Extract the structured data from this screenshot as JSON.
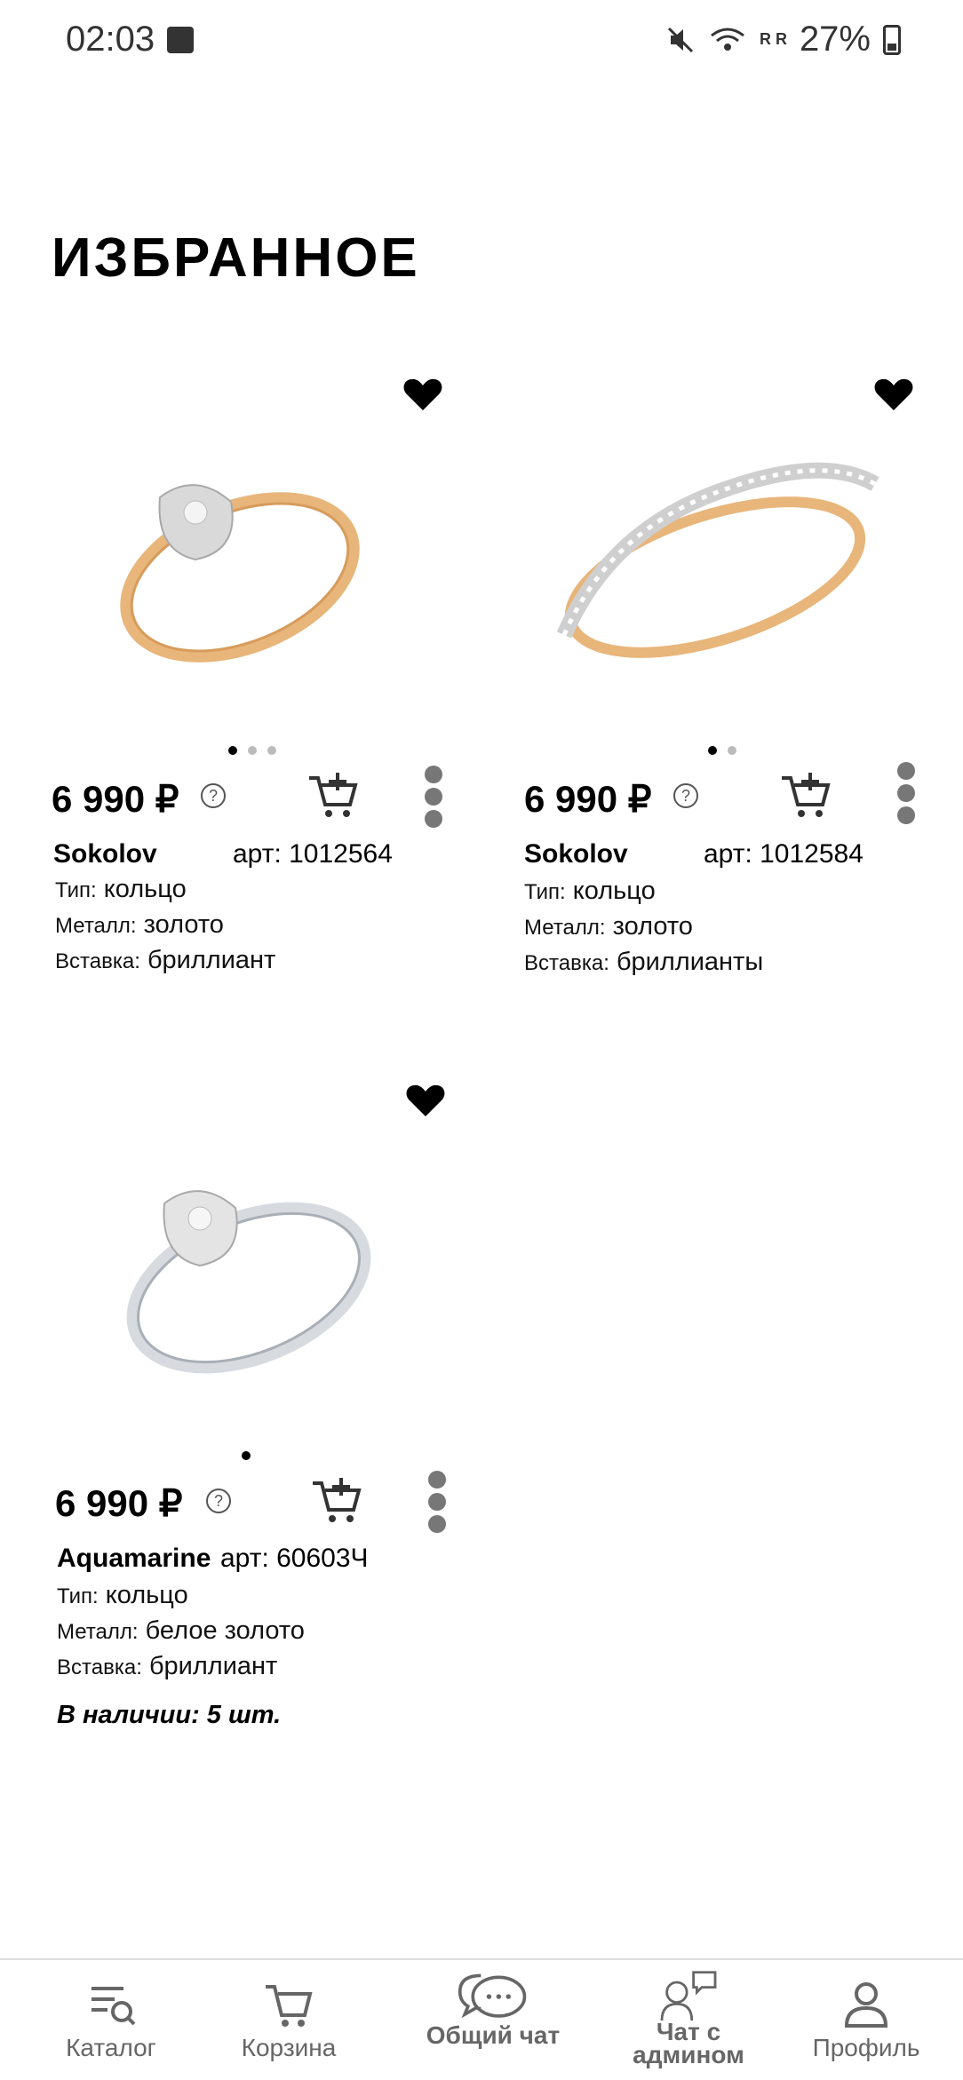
{
  "status_bar": {
    "time": "02:03",
    "signal_labels": "R R",
    "battery": "27%"
  },
  "page": {
    "title": "ИЗБРАННОЕ"
  },
  "products": [
    {
      "price": "6 990 ₽",
      "brand": "Sokolov",
      "article": "арт: 1012564",
      "type_label": "Тип:",
      "type_value": "кольцо",
      "metal_label": "Металл:",
      "metal_value": "золото",
      "insert_label": "Вставка:",
      "insert_value": "бриллиант",
      "image_dots": 3,
      "colors": {
        "band": "#e8b57a",
        "head": "#d9d9d9"
      }
    },
    {
      "price": "6 990 ₽",
      "brand": "Sokolov",
      "article": "арт: 1012584",
      "type_label": "Тип:",
      "type_value": "кольцо",
      "metal_label": "Металл:",
      "metal_value": "золото",
      "insert_label": "Вставка:",
      "insert_value": "бриллианты",
      "image_dots": 2,
      "colors": {
        "band": "#e8b57a",
        "head": "#d9d9d9"
      }
    },
    {
      "price": "6 990 ₽",
      "brand": "Aquamarine",
      "article": "арт: 60603Ч",
      "type_label": "Тип:",
      "type_value": "кольцо",
      "metal_label": "Металл:",
      "metal_value": "белое  золото",
      "insert_label": "Вставка:",
      "insert_value": "бриллиант",
      "stock": "В наличии: 5 шт.",
      "image_dots": 1,
      "colors": {
        "band": "#d7dbe0",
        "head": "#e4e4e4"
      }
    }
  ],
  "help_symbol": "?",
  "nav": {
    "catalog": "Каталог",
    "cart": "Корзина",
    "chat": "Общий чат",
    "admin_chat_line1": "Чат с",
    "admin_chat_line2": "админом",
    "profile": "Профиль"
  },
  "icons": [
    "heart-icon",
    "cart-add-icon",
    "more-icon",
    "help-icon",
    "catalog-search-icon",
    "cart-icon",
    "chat-bubbles-icon",
    "admin-chat-icon",
    "profile-icon"
  ]
}
